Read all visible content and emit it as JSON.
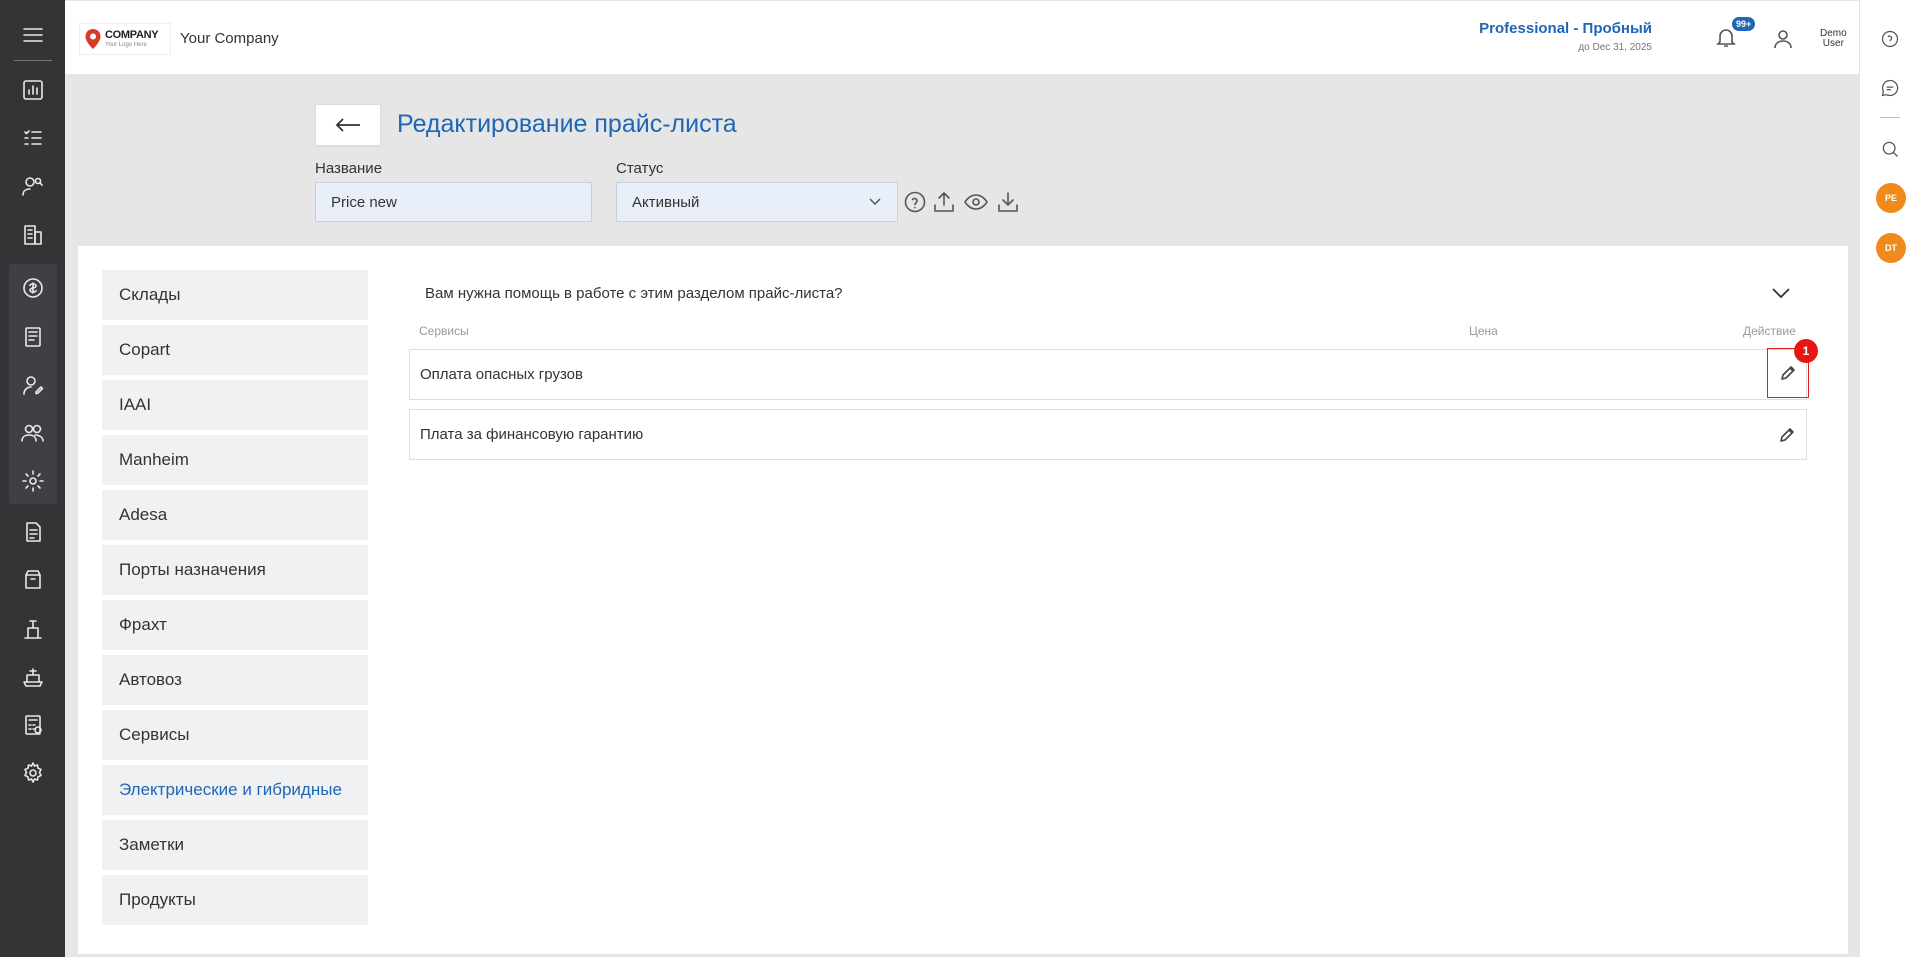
{
  "header": {
    "logo_text": "COMPANY",
    "logo_sub": "Your Logo Here",
    "company_name": "Your Company",
    "plan_name": "Professional - Пробный",
    "plan_until": "до Dec 31, 2025",
    "notifications_badge": "99+",
    "user_first": "Demo",
    "user_last": "User"
  },
  "page": {
    "title": "Редактирование прайс-листа",
    "name_label": "Название",
    "name_value": "Price new",
    "status_label": "Статус",
    "status_value": "Активный"
  },
  "nav": {
    "items": [
      {
        "label": "Склады"
      },
      {
        "label": "Copart"
      },
      {
        "label": "IAAI"
      },
      {
        "label": "Manheim"
      },
      {
        "label": "Adesa"
      },
      {
        "label": "Порты назначения"
      },
      {
        "label": "Фрахт"
      },
      {
        "label": "Автовоз"
      },
      {
        "label": "Сервисы"
      },
      {
        "label": "Электрические и гибридные",
        "active": true
      },
      {
        "label": "Заметки"
      },
      {
        "label": "Продукты"
      }
    ]
  },
  "content": {
    "help_text": "Вам нужна помощь в работе с этим разделом прайс-листа?",
    "columns": {
      "services": "Сервисы",
      "price": "Цена",
      "action": "Действие"
    },
    "rows": [
      {
        "service": "Оплата опасных грузов"
      },
      {
        "service": "Плата за финансовую гарантию"
      }
    ],
    "marker_label": "1"
  },
  "rightbar": {
    "avatars": [
      "PE",
      "DT"
    ]
  },
  "colors": {
    "accent": "#1f66b5",
    "sidebar": "#333436",
    "avatar": "#f08a1c",
    "marker": "#e81515"
  }
}
